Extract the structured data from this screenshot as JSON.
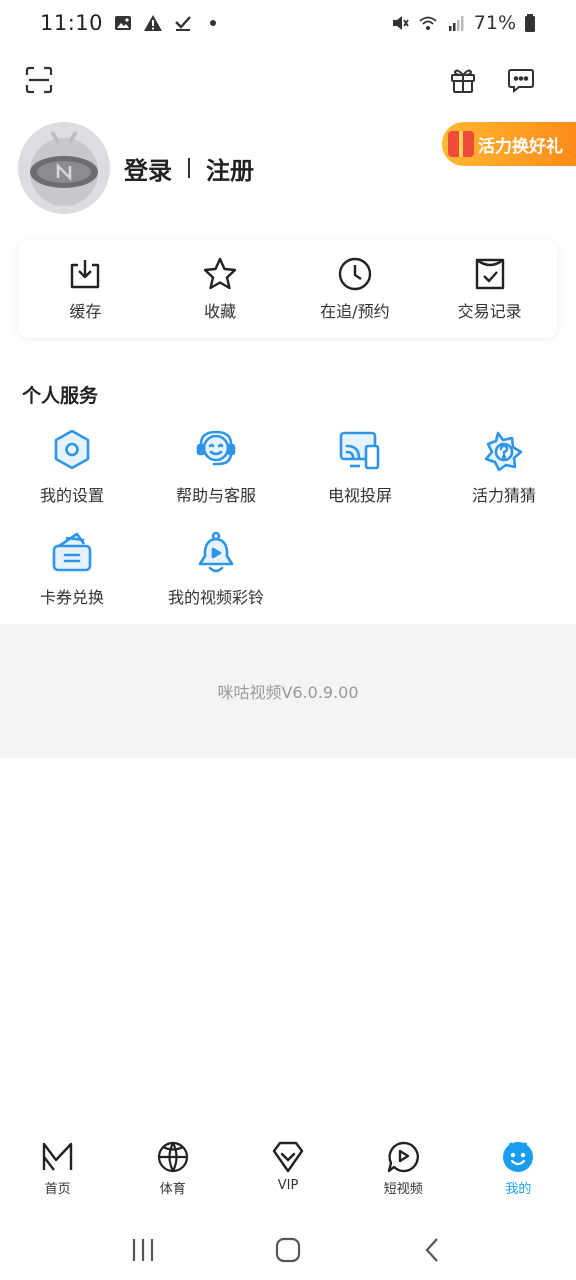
{
  "status": {
    "time": "11:10",
    "battery": "71%"
  },
  "profile": {
    "login": "登录",
    "register": "注册",
    "promo": "活力换好礼"
  },
  "quick": [
    {
      "label": "缓存",
      "icon": "download-icon"
    },
    {
      "label": "收藏",
      "icon": "star-icon"
    },
    {
      "label": "在追/预约",
      "icon": "clock-icon"
    },
    {
      "label": "交易记录",
      "icon": "receipt-check-icon"
    }
  ],
  "section_title": "个人服务",
  "services": [
    {
      "label": "我的设置",
      "icon": "settings-hexagon-icon"
    },
    {
      "label": "帮助与客服",
      "icon": "headset-icon"
    },
    {
      "label": "电视投屏",
      "icon": "cast-screen-icon"
    },
    {
      "label": "活力猜猜",
      "icon": "question-star-icon"
    },
    {
      "label": "卡券兑换",
      "icon": "coupon-wallet-icon"
    },
    {
      "label": "我的视频彩铃",
      "icon": "bell-icon"
    }
  ],
  "version": "咪咕视频V6.0.9.00",
  "nav": [
    {
      "label": "首页",
      "icon": "home-logo-icon"
    },
    {
      "label": "体育",
      "icon": "basketball-icon"
    },
    {
      "label": "VIP",
      "icon": "vip-heart-icon"
    },
    {
      "label": "短视频",
      "icon": "play-bubble-icon"
    },
    {
      "label": "我的",
      "icon": "mascot-icon"
    }
  ],
  "colors": {
    "accent": "#1a9ff0",
    "icon_blue": "#2f95e6",
    "promo": "#ff9a1f"
  }
}
